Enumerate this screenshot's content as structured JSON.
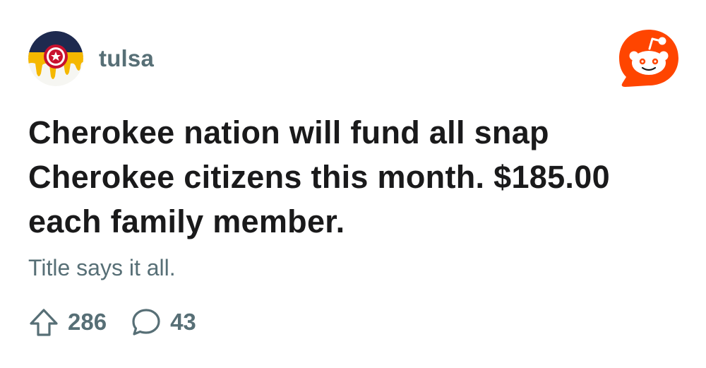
{
  "post": {
    "subreddit": "tulsa",
    "title": "Cherokee nation will fund all snap Cherokee citizens this month. $185.00 each family member.",
    "body": "Title says it all.",
    "upvotes": "286",
    "comments": "43"
  },
  "icons": {
    "avatar": "tulsa-flag-icon",
    "brand": "reddit-logo-icon",
    "upvote": "upvote-arrow-icon",
    "comment": "comment-bubble-icon"
  },
  "colors": {
    "brand_orange": "#ff4500",
    "title_text": "#1a1a1b",
    "meta_text": "#576f76",
    "flag_navy": "#1e2a4f",
    "flag_gold": "#f5b800",
    "flag_red": "#c8102e"
  }
}
